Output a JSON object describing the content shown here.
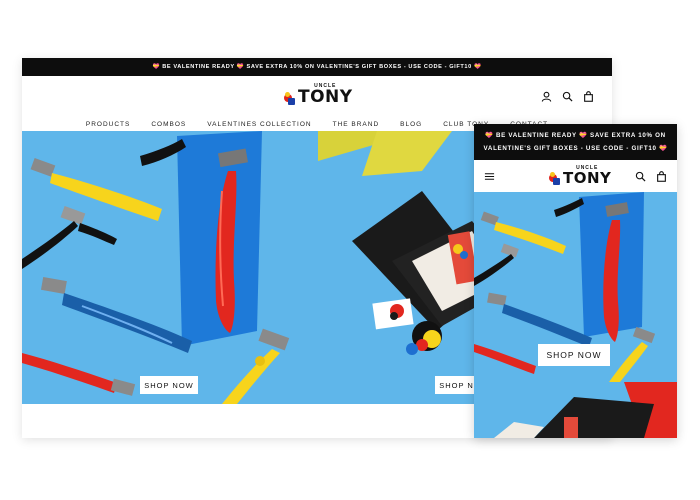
{
  "announcement": "💝 BE VALENTINE READY 💝 SAVE EXTRA 10% ON VALENTINE'S GIFT BOXES - USE CODE - GIFT10 💝",
  "mobile_announcement": {
    "line1": "💝 BE VALENTINE READY 💝 SAVE EXTRA 10% ON",
    "line2": "VALENTINE'S GIFT BOXES - USE CODE - GIFT10 💝"
  },
  "logo": {
    "top": "UNCLE",
    "main": "TONY"
  },
  "nav": [
    "PRODUCTS",
    "COMBOS",
    "VALENTINES COLLECTION",
    "THE BRAND",
    "BLOG",
    "CLUB TONY",
    "CONTACT"
  ],
  "icons": {
    "account": "account-icon",
    "search": "search-icon",
    "cart": "cart-icon",
    "menu": "menu-icon"
  },
  "hero": {
    "left_button": "SHOP NOW",
    "right_button": "SHOP NOW",
    "mobile_button": "SHOP NOW"
  },
  "colors": {
    "announcement_bg": "#0d0d0d",
    "hero_blue": "#5bb4e8",
    "accent_red": "#e0231d",
    "accent_yellow": "#f8d21b"
  }
}
